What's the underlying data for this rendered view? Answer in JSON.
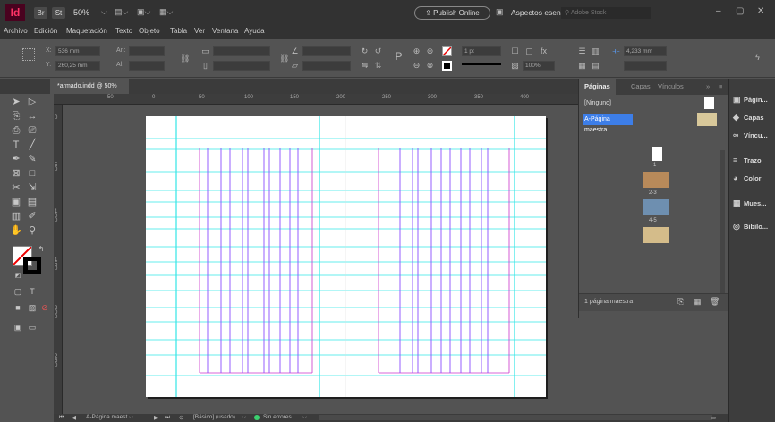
{
  "app": {
    "logo": "Id",
    "bridge_label": "Br",
    "stock_label": "St",
    "zoom": "50%",
    "publish_label": "Publish Online",
    "workspace": "Aspectos esenciales clásicos",
    "search_placeholder": "Adobe Stock"
  },
  "menu": [
    "Archivo",
    "Edición",
    "Maquetación",
    "Texto",
    "Objeto",
    "Tabla",
    "Ver",
    "Ventana",
    "Ayuda"
  ],
  "control": {
    "x_label": "X:",
    "x_value": "536 mm",
    "y_label": "Y:",
    "y_value": "260,25 mm",
    "w_label": "An:",
    "h_label": "Al:",
    "stroke_weight": "1 pt",
    "opacity": "100%",
    "offset": "4,233 mm"
  },
  "document": {
    "tab_label": "*armado.indd @ 50%",
    "close": "×"
  },
  "ruler": {
    "h": [
      "50",
      "0",
      "50",
      "100",
      "150",
      "200",
      "250",
      "300",
      "350",
      "400"
    ],
    "v": [
      "0",
      "5 0",
      "1 0 0",
      "1 5 0",
      "2 0 0",
      "2 5 0"
    ]
  },
  "pages_panel": {
    "tabs": [
      "Páginas",
      "Capas",
      "Vínculos"
    ],
    "none_label": "[Ninguno]",
    "master_label": "A-Página maestra",
    "page_labels": [
      "1",
      "2-3",
      "4-5"
    ],
    "footer_text": "1 página maestra"
  },
  "right_panels": [
    "Págin...",
    "Capas",
    "Víncu...",
    "Trazo",
    "Color",
    "Mues...",
    "Bibilo..."
  ],
  "status": {
    "page_select": "A-Página maest",
    "style": "[Básico] (usado)",
    "errors": "Sin errores"
  },
  "colors": {
    "bg": "#535353",
    "titlebar": "#323232",
    "accent": "#49021f",
    "guide_cyan": "#33e6e6",
    "margin_magenta": "#cc33cc",
    "column_violet": "#8a4dff",
    "selection": "#3d7ee8"
  }
}
